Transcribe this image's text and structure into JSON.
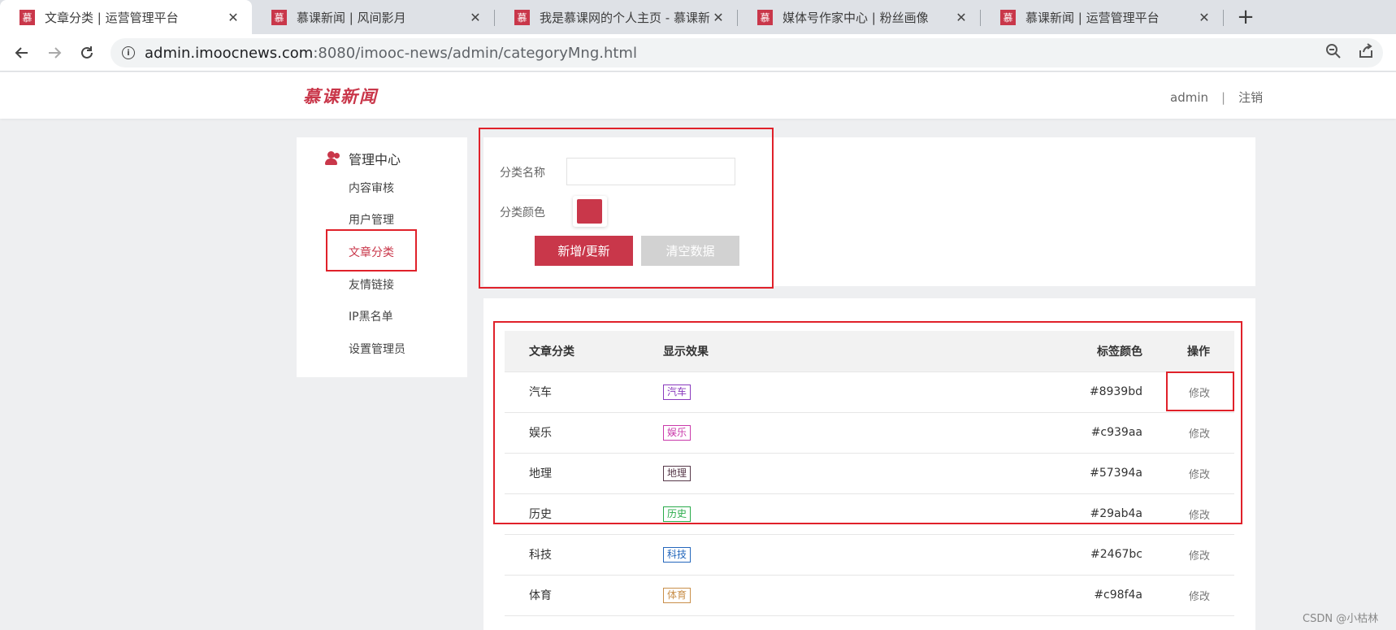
{
  "browser": {
    "tabs": [
      {
        "title": "文章分类 | 运营管理平台",
        "active": true
      },
      {
        "title": "慕课新闻 | 风间影月",
        "active": false
      },
      {
        "title": "我是慕课网的个人主页 - 慕课新闻",
        "active": false
      },
      {
        "title": "媒体号作家中心 | 粉丝画像",
        "active": false
      },
      {
        "title": "慕课新闻 | 运营管理平台",
        "active": false
      }
    ],
    "favicon_glyph": "慕",
    "new_tab_glyph": "+",
    "close_glyph": "✕",
    "url_host": "admin.imoocnews.com",
    "url_rest": ":8080/imooc-news/admin/categoryMng.html"
  },
  "header": {
    "logo": "慕课新闻",
    "username": "admin",
    "separator": "|",
    "logout": "注销"
  },
  "sidebar": {
    "title": "管理中心",
    "items": [
      {
        "label": "内容审核",
        "active": false
      },
      {
        "label": "用户管理",
        "active": false
      },
      {
        "label": "文章分类",
        "active": true
      },
      {
        "label": "友情链接",
        "active": false
      },
      {
        "label": "IP黑名单",
        "active": false
      },
      {
        "label": "设置管理员",
        "active": false
      }
    ]
  },
  "form": {
    "name_label": "分类名称",
    "name_value": "",
    "color_label": "分类颜色",
    "color_value": "#c9374a",
    "submit_label": "新增/更新",
    "clear_label": "清空数据"
  },
  "table": {
    "headers": [
      "文章分类",
      "显示效果",
      "标签颜色",
      "操作"
    ],
    "rows": [
      {
        "name": "汽车",
        "tag": "汽车",
        "color": "#8939bd",
        "action": "修改"
      },
      {
        "name": "娱乐",
        "tag": "娱乐",
        "color": "#c939aa",
        "action": "修改"
      },
      {
        "name": "地理",
        "tag": "地理",
        "color": "#57394a",
        "action": "修改"
      },
      {
        "name": "历史",
        "tag": "历史",
        "color": "#29ab4a",
        "action": "修改"
      },
      {
        "name": "科技",
        "tag": "科技",
        "color": "#2467bc",
        "action": "修改"
      },
      {
        "name": "体育",
        "tag": "体育",
        "color": "#c98f4a",
        "action": "修改"
      }
    ]
  },
  "watermark": "CSDN @小枯林"
}
